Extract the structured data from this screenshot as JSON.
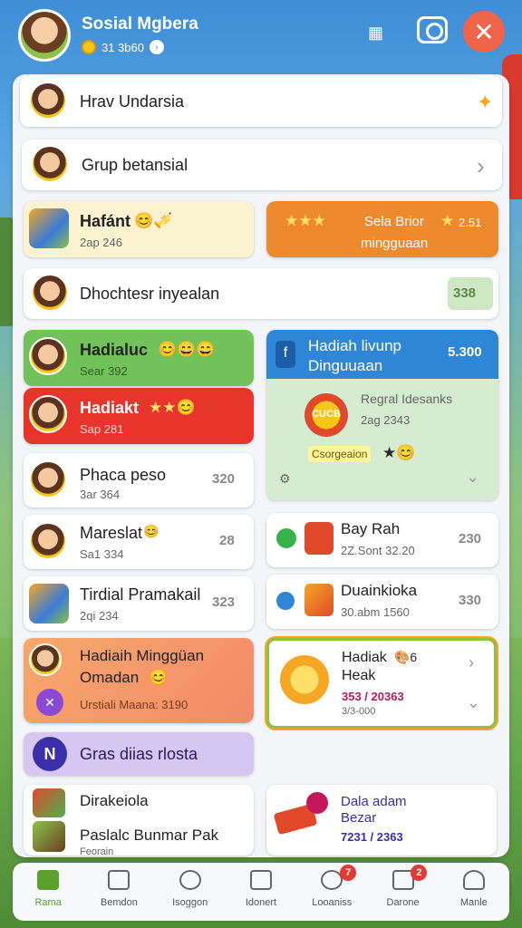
{
  "header": {
    "title": "Sosial Mgbera",
    "sub_text": "31 3b60",
    "grid_icon": "grid-icon",
    "camera_icon": "camera-icon",
    "close_icon": "close-icon",
    "close_glyph": "✕"
  },
  "rows": {
    "r1": {
      "title": "Hrav Undarsia",
      "action": "✦"
    },
    "r2": {
      "title": "Grup betansial",
      "action": "›"
    },
    "r3a": {
      "title": "Hafánt",
      "sub": "2ap 246",
      "emoji": "😊🎺"
    },
    "r3b": {
      "title": "Sela Brior",
      "title2": "mingguaan",
      "value": "2.51",
      "emoji": "★★★",
      "emoji2": "★"
    },
    "r4": {
      "title": "Dhochtesr inyealan",
      "value": "338"
    },
    "r5a": {
      "title": "Hadialuc",
      "sub": "Sear 392",
      "emoji": "😊😄😄"
    },
    "r5b": {
      "title": "Hadiah livunp",
      "title2": "Dinguuaan",
      "value": "5.300"
    },
    "r5b_inner": {
      "badge": "CUCB",
      "title": "Regral Idesanks",
      "sub": "2ag 2343",
      "tag": "Csorgeaion",
      "emoji": "★😊"
    },
    "r6a": {
      "title": "Hadiakt",
      "sub": "Sap 281",
      "emoji": "★★😊"
    },
    "r7a": {
      "title": "Phaca peso",
      "sub": "3ar 364",
      "value": "320"
    },
    "r8a": {
      "title": "Mareslat",
      "sub": "Sa1 334",
      "value": "28",
      "emoji": "😊"
    },
    "r8b": {
      "title": "Bay Rah",
      "sub": "2Z.Sont 32.20",
      "value": "230"
    },
    "r9a": {
      "title": "Tirdial Pramakail",
      "sub": "2qi 234",
      "value": "323"
    },
    "r9b": {
      "title": "Duainkioka",
      "sub": "30.abm 1560",
      "value": "330"
    },
    "r10a": {
      "title": "Hadiaih Minggüan",
      "title2": "Omadan",
      "sub": "Urstiali Maana: 3190",
      "emoji": "😊"
    },
    "r10b": {
      "title": "Hadiak",
      "title2": "Heak",
      "sub": "353 / 20363",
      "sub2": "3/3-000",
      "emoji": "🎨6"
    },
    "r11a": {
      "title": "Gras diias rlosta",
      "badge": "N"
    },
    "r12a": {
      "title": "Dirakeiola",
      "title2": "Paslalc Bunmar Pak",
      "sub": "Feorain"
    },
    "r12b": {
      "title": "Dala adam",
      "title2": "Bezar",
      "sub": "7231 / 2363"
    }
  },
  "nav": [
    {
      "label": "Rama",
      "icon": "home-icon",
      "badge": ""
    },
    {
      "label": "Bemdon",
      "icon": "store-icon",
      "badge": ""
    },
    {
      "label": "Isoggon",
      "icon": "chat-icon",
      "badge": ""
    },
    {
      "label": "Idonert",
      "icon": "inbox-icon",
      "badge": ""
    },
    {
      "label": "Looaniss",
      "icon": "clock-icon",
      "badge": "7"
    },
    {
      "label": "Darone",
      "icon": "gift-icon",
      "badge": "2"
    },
    {
      "label": "Manle",
      "icon": "profile-icon",
      "badge": ""
    }
  ],
  "fab": {
    "glyph": "✕",
    "icon": "close-icon"
  },
  "colors": {
    "accent_green": "#5aa02c",
    "orange": "#f05a28",
    "red_card": "#e8352c",
    "blue_card": "#2f86d6"
  }
}
